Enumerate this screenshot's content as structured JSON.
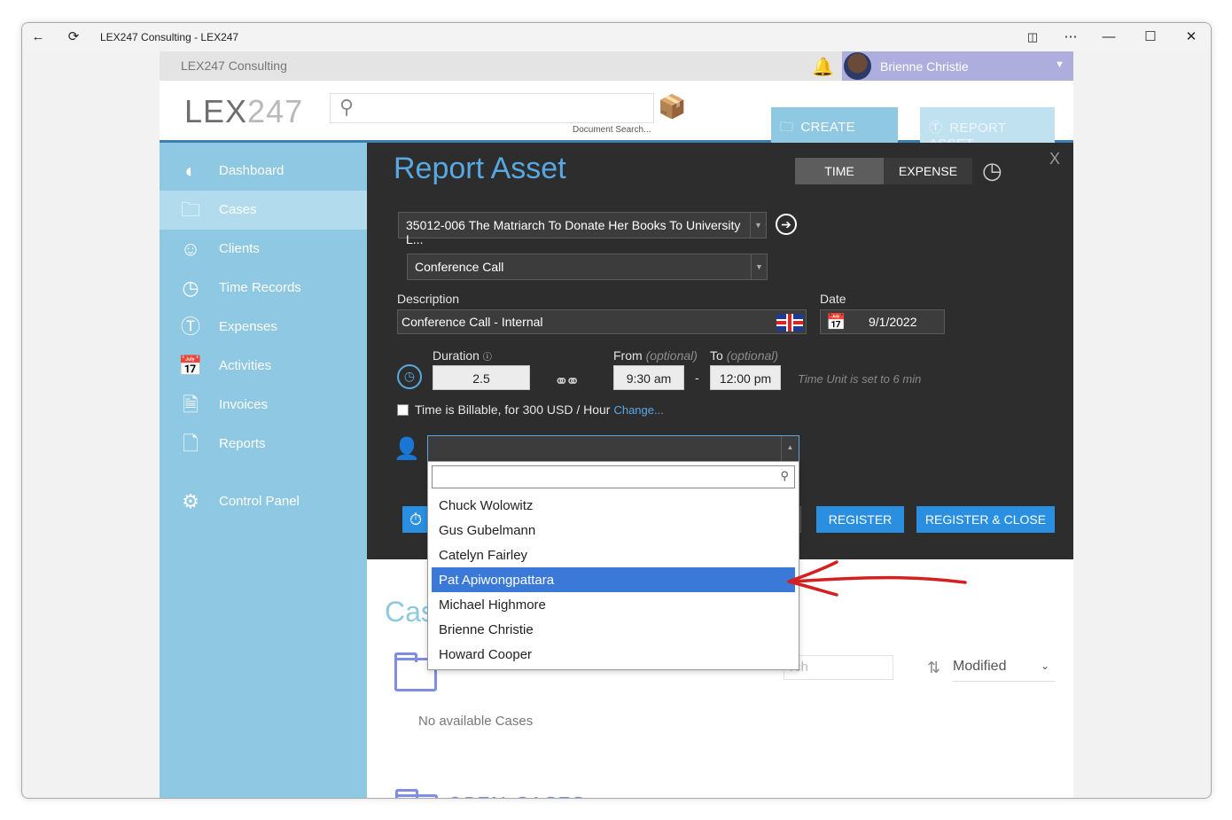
{
  "window": {
    "title": "LEX247 Consulting - LEX247"
  },
  "topbar": {
    "firm_name": "LEX247 Consulting",
    "user_name": "Brienne Christie"
  },
  "header": {
    "logo_main": "LEX",
    "logo_num": "247",
    "doc_search_label": "Document Search...",
    "create_case": "CREATE CASE",
    "report_asset": "REPORT ASSET"
  },
  "sidebar": {
    "items": [
      {
        "label": "Dashboard",
        "icon": "dashboard-icon"
      },
      {
        "label": "Cases",
        "icon": "folder-icon"
      },
      {
        "label": "Clients",
        "icon": "clients-icon"
      },
      {
        "label": "Time Records",
        "icon": "clock-icon"
      },
      {
        "label": "Expenses",
        "icon": "dollar-icon"
      },
      {
        "label": "Activities",
        "icon": "calendar-icon"
      },
      {
        "label": "Invoices",
        "icon": "invoice-icon"
      },
      {
        "label": "Reports",
        "icon": "report-icon"
      },
      {
        "label": "Control Panel",
        "icon": "gears-icon"
      }
    ]
  },
  "report_asset": {
    "title": "Report Asset",
    "toggle_time": "TIME",
    "toggle_expense": "EXPENSE",
    "close": "X",
    "case_select": "35012-006 The Matriarch To Donate Her Books To University L...",
    "activity_select": "Conference Call",
    "description_label": "Description",
    "description_value": "Conference Call - Internal",
    "date_label": "Date",
    "date_value": "9/1/2022",
    "duration_label": "Duration",
    "duration_value": "2.5",
    "from_label": "From",
    "optional": "(optional)",
    "from_value": "9:30 am",
    "dash": "-",
    "to_label": "To",
    "to_value": "12:00 pm",
    "time_unit_hint": "Time Unit is set to 6 min",
    "billable_text": "Time is Billable, for 300 USD / Hour",
    "change_link": "Change...",
    "register": "REGISTER",
    "register_close": "REGISTER & CLOSE"
  },
  "user_dropdown": {
    "items": [
      "Chuck Wolowitz",
      "Gus Gubelmann",
      "Catelyn Fairley",
      "Pat Apiwongpattara",
      "Michael Highmore",
      "Brienne Christie",
      "Howard Cooper"
    ],
    "selected": "Pat Apiwongpattara"
  },
  "cases_page": {
    "title": "Cas",
    "search_placeholder": "rch",
    "sort_value": "Modified",
    "no_cases": "No available Cases",
    "open_cases": "OPEN CASES"
  },
  "colors": {
    "sidebar": "#8ec8e2",
    "panel": "#2d2d2d",
    "accent_blue": "#2a8fe0",
    "title_blue": "#58a8e3",
    "selected_item": "#3b79d9",
    "annotation_arrow": "#d42020"
  }
}
